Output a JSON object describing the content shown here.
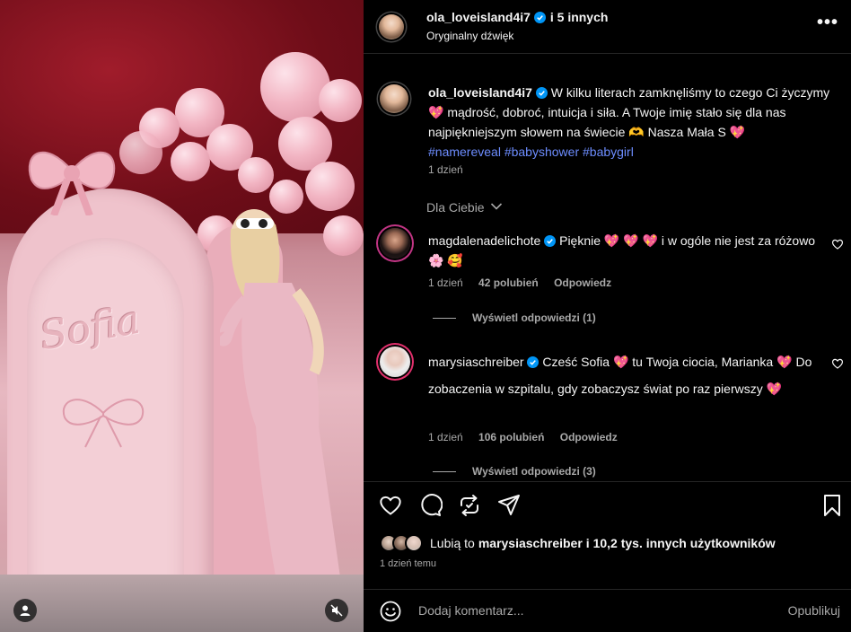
{
  "media": {
    "overlay_text": "Sofia"
  },
  "header": {
    "username": "ola_loveisland4i7",
    "coauthors": "i 5 innych",
    "audio": "Oryginalny dźwięk",
    "more_label": "•••"
  },
  "caption": {
    "username": "ola_loveisland4i7",
    "text_1": "W kilku literach zamknęliśmy to czego Ci życzymy",
    "emoji_1": "💖",
    "text_2": "mądrość, dobroć, intuicja i siła. A Twoje imię stało się dla nas najpiękniejszym słowem na świecie",
    "emoji_2": "🫶",
    "text_3": "Nasza Mała S",
    "emoji_3": "💖",
    "hashtags": [
      "#namereveal",
      "#babyshower",
      "#babygirl"
    ],
    "time": "1 dzień"
  },
  "filter": {
    "label": "Dla Ciebie"
  },
  "comments": [
    {
      "username": "magdalenadelichote",
      "text_a": "Pięknie",
      "emojis_a": "💖 💖 💖",
      "text_b": "i w ogóle nie jest za różowo",
      "emojis_b": "🌸 🥰",
      "time": "1 dzień",
      "likes": "42 polubień",
      "reply": "Odpowiedz",
      "view_replies": "Wyświetl odpowiedzi (1)"
    },
    {
      "username": "marysiaschreiber",
      "text_a": "Cześć Sofia",
      "emoji_a": "💖",
      "text_b": "tu Twoja ciocia, Marianka",
      "emoji_b": "💖",
      "text_c": "Do zobaczenia w szpitalu, gdy zobaczysz świat po raz pierwszy",
      "emoji_c": "💖",
      "time": "1 dzień",
      "likes": "106 polubień",
      "reply": "Odpowiedz",
      "view_replies": "Wyświetl odpowiedzi (3)"
    }
  ],
  "likes": {
    "prefix": "Lubią to",
    "user": "marysiaschreiber",
    "suffix": "i 10,2 tys. innych użytkowników"
  },
  "post_date": "1 dzień temu",
  "add_comment": {
    "placeholder": "Dodaj komentarz...",
    "publish": "Opublikuj"
  },
  "colors": {
    "background": "#000000",
    "text": "#f5f5f5",
    "muted": "#a8a8a8",
    "hashtag": "#6d8dff",
    "verified": "#0095f6",
    "heart": "#ff3b7a"
  }
}
